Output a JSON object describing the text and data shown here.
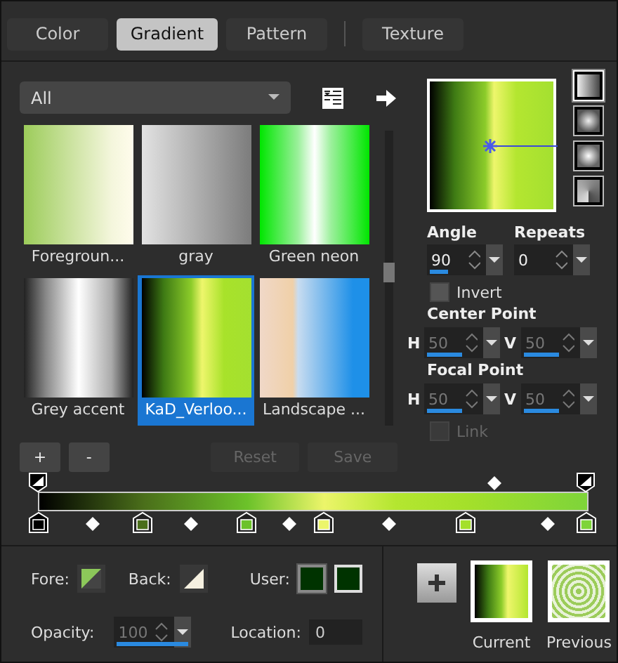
{
  "tabs": [
    {
      "label": "Color",
      "selected": false
    },
    {
      "label": "Gradient",
      "selected": true
    },
    {
      "label": "Pattern",
      "selected": false
    },
    {
      "label": "Texture",
      "selected": false
    }
  ],
  "category": {
    "value": "All"
  },
  "gradients": [
    {
      "name": "Foregroun...",
      "selected": false
    },
    {
      "name": "gray",
      "selected": false
    },
    {
      "name": "Green neon",
      "selected": false
    },
    {
      "name": "Grey accent",
      "selected": false
    },
    {
      "name": "KaD_Verloo...",
      "selected": true
    },
    {
      "name": "Landscape ...",
      "selected": false
    }
  ],
  "list_buttons": [
    {
      "label": "+",
      "disabled": false
    },
    {
      "label": "-",
      "disabled": false
    },
    {
      "label": "Reset",
      "disabled": true
    },
    {
      "label": "Save",
      "disabled": true
    }
  ],
  "styles": [
    {
      "kind": "linear",
      "selected": true
    },
    {
      "kind": "rectangular",
      "selected": false
    },
    {
      "kind": "sunburst",
      "selected": false
    },
    {
      "kind": "radial",
      "selected": false
    }
  ],
  "angle": {
    "label": "Angle",
    "value": "90",
    "level": 0.25
  },
  "repeats": {
    "label": "Repeats",
    "value": "0"
  },
  "invert": {
    "label": "Invert",
    "checked": false,
    "disabled": false
  },
  "center_point": {
    "label": "Center Point",
    "h": {
      "label": "H",
      "value": "50",
      "level": 0.5,
      "disabled": true
    },
    "v": {
      "label": "V",
      "value": "50",
      "level": 0.5,
      "disabled": true
    }
  },
  "focal_point": {
    "label": "Focal Point",
    "h": {
      "label": "H",
      "value": "50",
      "level": 0.5,
      "disabled": true
    },
    "v": {
      "label": "V",
      "value": "50",
      "level": 0.5,
      "disabled": true
    }
  },
  "link": {
    "label": "Link",
    "checked": false,
    "disabled": true
  },
  "color_stops": [
    {
      "color": "#000000",
      "selected": true
    },
    {
      "color": "#4a6e1a",
      "selected": false
    },
    {
      "color": "#6cc22a",
      "selected": false
    },
    {
      "color": "#ecf56a",
      "selected": false
    },
    {
      "color": "#a4e02a",
      "selected": false
    },
    {
      "color": "#7ed43a",
      "selected": false
    }
  ],
  "fore": {
    "label": "Fore:"
  },
  "back": {
    "label": "Back:"
  },
  "user": {
    "label": "User:",
    "colors": [
      {
        "color": "#003300",
        "selected": true
      },
      {
        "color": "#003300",
        "selected": false
      }
    ]
  },
  "opacity": {
    "label": "Opacity:",
    "value": "100",
    "level": 1,
    "disabled": true
  },
  "location": {
    "label": "Location:",
    "value": "0"
  },
  "current": {
    "label": "Current"
  },
  "previous": {
    "label": "Previous"
  }
}
